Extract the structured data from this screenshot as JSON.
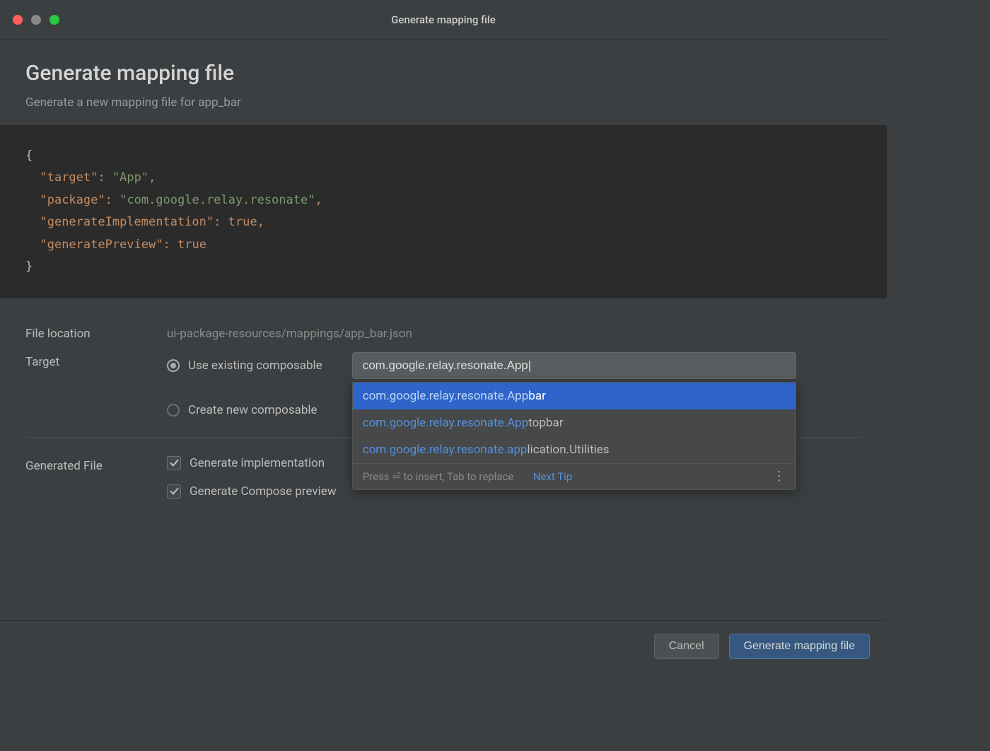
{
  "titlebar": {
    "title": "Generate mapping file"
  },
  "header": {
    "title": "Generate mapping file",
    "subtitle": "Generate a new mapping file for app_bar"
  },
  "code": {
    "target_key": "\"target\"",
    "target_val": "\"App\"",
    "package_key": "\"package\"",
    "package_val": "\"com.google.relay.resonate\"",
    "genimpl_key": "\"generateImplementation\"",
    "genimpl_val": "true",
    "genprev_key": "\"generatePreview\"",
    "genprev_val": "true"
  },
  "form": {
    "file_location_label": "File location",
    "file_location_value": "ui-package-resources/mappings/app_bar.json",
    "target_label": "Target",
    "radio_existing": "Use existing composable",
    "radio_new": "Create new composable",
    "target_input_value": "com.google.relay.resonate.App|",
    "generated_file_label": "Generated File",
    "check_impl": "Generate implementation",
    "check_preview": "Generate Compose preview"
  },
  "autocomplete": {
    "items": [
      {
        "match": "com.google.relay.resonate.App",
        "rest": "bar"
      },
      {
        "match": "com.google.relay.resonate.App",
        "rest": "topbar"
      },
      {
        "match": "com.google.relay.resonate.app",
        "rest": "lication.Utilities"
      }
    ],
    "hint": "Press ⏎ to insert, Tab to replace",
    "next_tip": "Next Tip"
  },
  "footer": {
    "cancel": "Cancel",
    "generate": "Generate mapping file"
  }
}
